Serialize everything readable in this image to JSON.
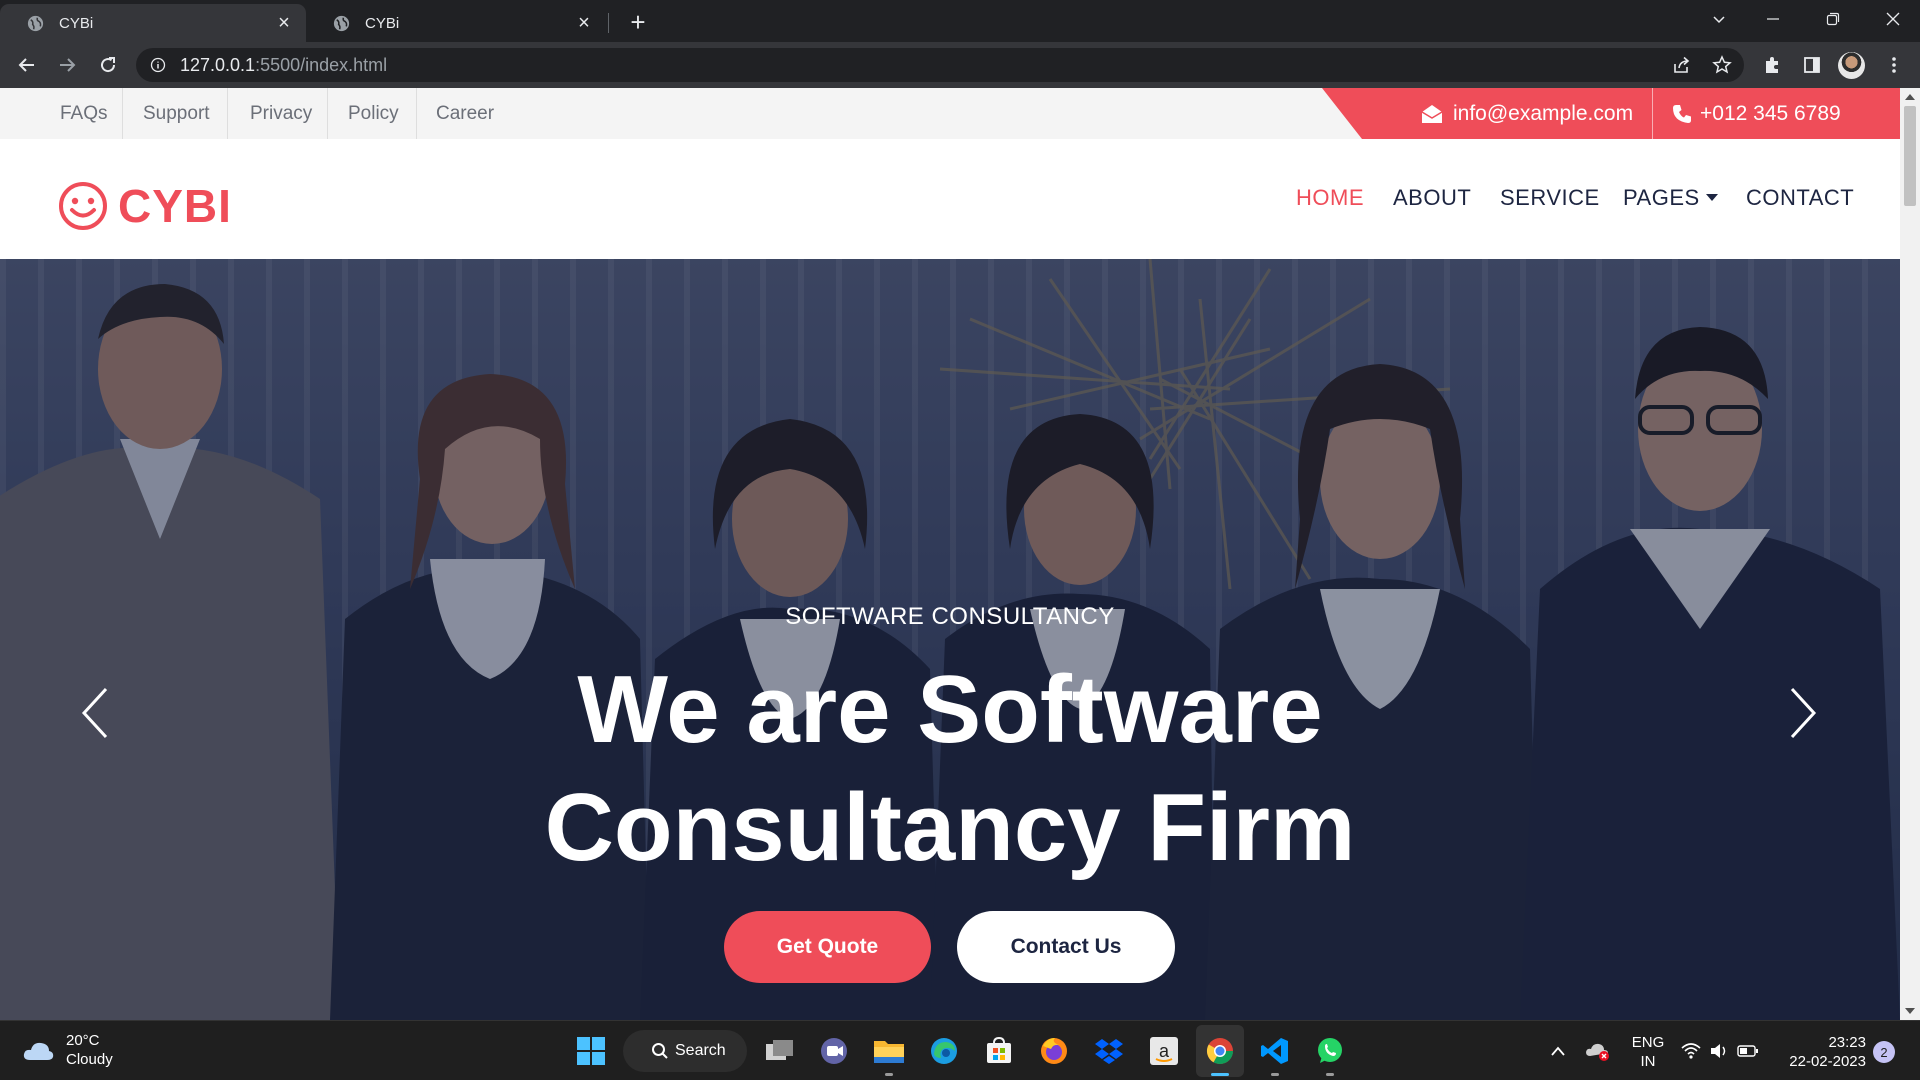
{
  "browser": {
    "tabs": [
      {
        "title": "CYBi",
        "active": true
      },
      {
        "title": "CYBi",
        "active": false
      }
    ],
    "url_host": "127.0.0.1",
    "url_rest": ":5500/index.html"
  },
  "topbar": {
    "links": [
      "FAQs",
      "Support",
      "Privacy",
      "Policy",
      "Career"
    ],
    "email": "info@example.com",
    "phone": "+012 345 6789"
  },
  "brand": {
    "name": "CYBI",
    "accent": "#ef4d59",
    "dark": "#1d2541"
  },
  "nav": {
    "items": [
      "HOME",
      "ABOUT",
      "SERVICE",
      "PAGES",
      "CONTACT"
    ],
    "active": "HOME"
  },
  "hero": {
    "subtitle": "SOFTWARE CONSULTANCY",
    "title_line1": "We are Software",
    "title_line2": "Consultancy Firm",
    "btn_primary": "Get Quote",
    "btn_secondary": "Contact Us"
  },
  "taskbar": {
    "temperature": "20°C",
    "weather": "Cloudy",
    "search_label": "Search",
    "lang_top": "ENG",
    "lang_bottom": "IN",
    "time": "23:23",
    "date": "22-02-2023",
    "notifications": "2",
    "pinned_apps": [
      "start-icon",
      "search-icon",
      "task-view-icon",
      "teams-icon",
      "file-explorer-icon",
      "edge-icon",
      "store-icon",
      "firefox-icon",
      "dropbox-icon",
      "amazon-icon",
      "chrome-icon",
      "vscode-icon",
      "whatsapp-icon"
    ]
  }
}
